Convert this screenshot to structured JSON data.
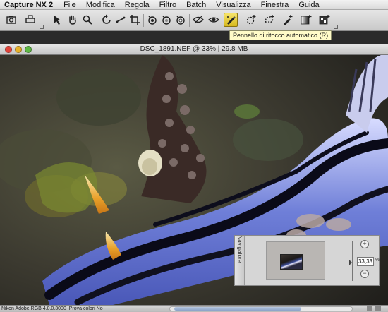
{
  "menubar": {
    "app": "Capture NX 2",
    "items": [
      "File",
      "Modifica",
      "Regola",
      "Filtro",
      "Batch",
      "Visualizza",
      "Finestra",
      "Guida"
    ]
  },
  "toolbar": {
    "tooltip": "Pennello di ritocco automatico (R)",
    "active_tool": "auto-retouch-brush-icon"
  },
  "document": {
    "title": "DSC_1891.NEF @ 33% | 29.8 MB"
  },
  "navigator": {
    "label": "Navigatore",
    "zoom_value": "33,33",
    "zoom_unit": "%"
  },
  "statusbar": {
    "profile": "Nikon Adobe RGB 4.0.0.3000",
    "proof": "Prova colori No"
  },
  "colors": {
    "active_tool": "#e3c636",
    "tooltip_bg": "#fffbc8"
  }
}
